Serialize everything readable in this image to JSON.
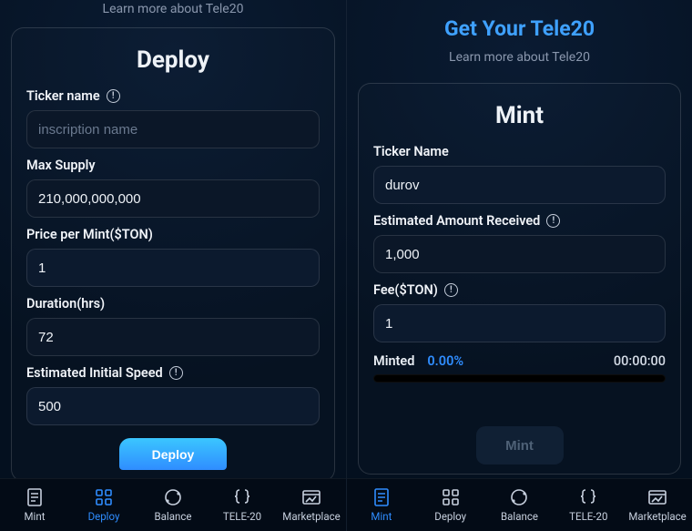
{
  "learn_more": "Learn more about Tele20",
  "hero": "Get Your Tele20",
  "deploy_card": {
    "title": "Deploy",
    "ticker_label": "Ticker name",
    "ticker_placeholder": "inscription name",
    "max_supply_label": "Max Supply",
    "max_supply_value": "210,000,000,000",
    "price_label": "Price per Mint($TON)",
    "price_value": "1",
    "duration_label": "Duration(hrs)",
    "duration_value": "72",
    "speed_label": "Estimated Initial Speed",
    "speed_value": "500",
    "action": "Deploy"
  },
  "mint_card": {
    "title": "Mint",
    "ticker_label": "Ticker Name",
    "ticker_value": "durov",
    "est_label": "Estimated Amount Received",
    "est_value": "1,000",
    "fee_label": "Fee($TON)",
    "fee_value": "1",
    "minted_label": "Minted",
    "minted_pct": "0.00%",
    "minted_timer": "00:00:00",
    "action": "Mint"
  },
  "nav": [
    {
      "label": "Mint"
    },
    {
      "label": "Deploy"
    },
    {
      "label": "Balance"
    },
    {
      "label": "TELE-20"
    },
    {
      "label": "Marketplace"
    }
  ]
}
